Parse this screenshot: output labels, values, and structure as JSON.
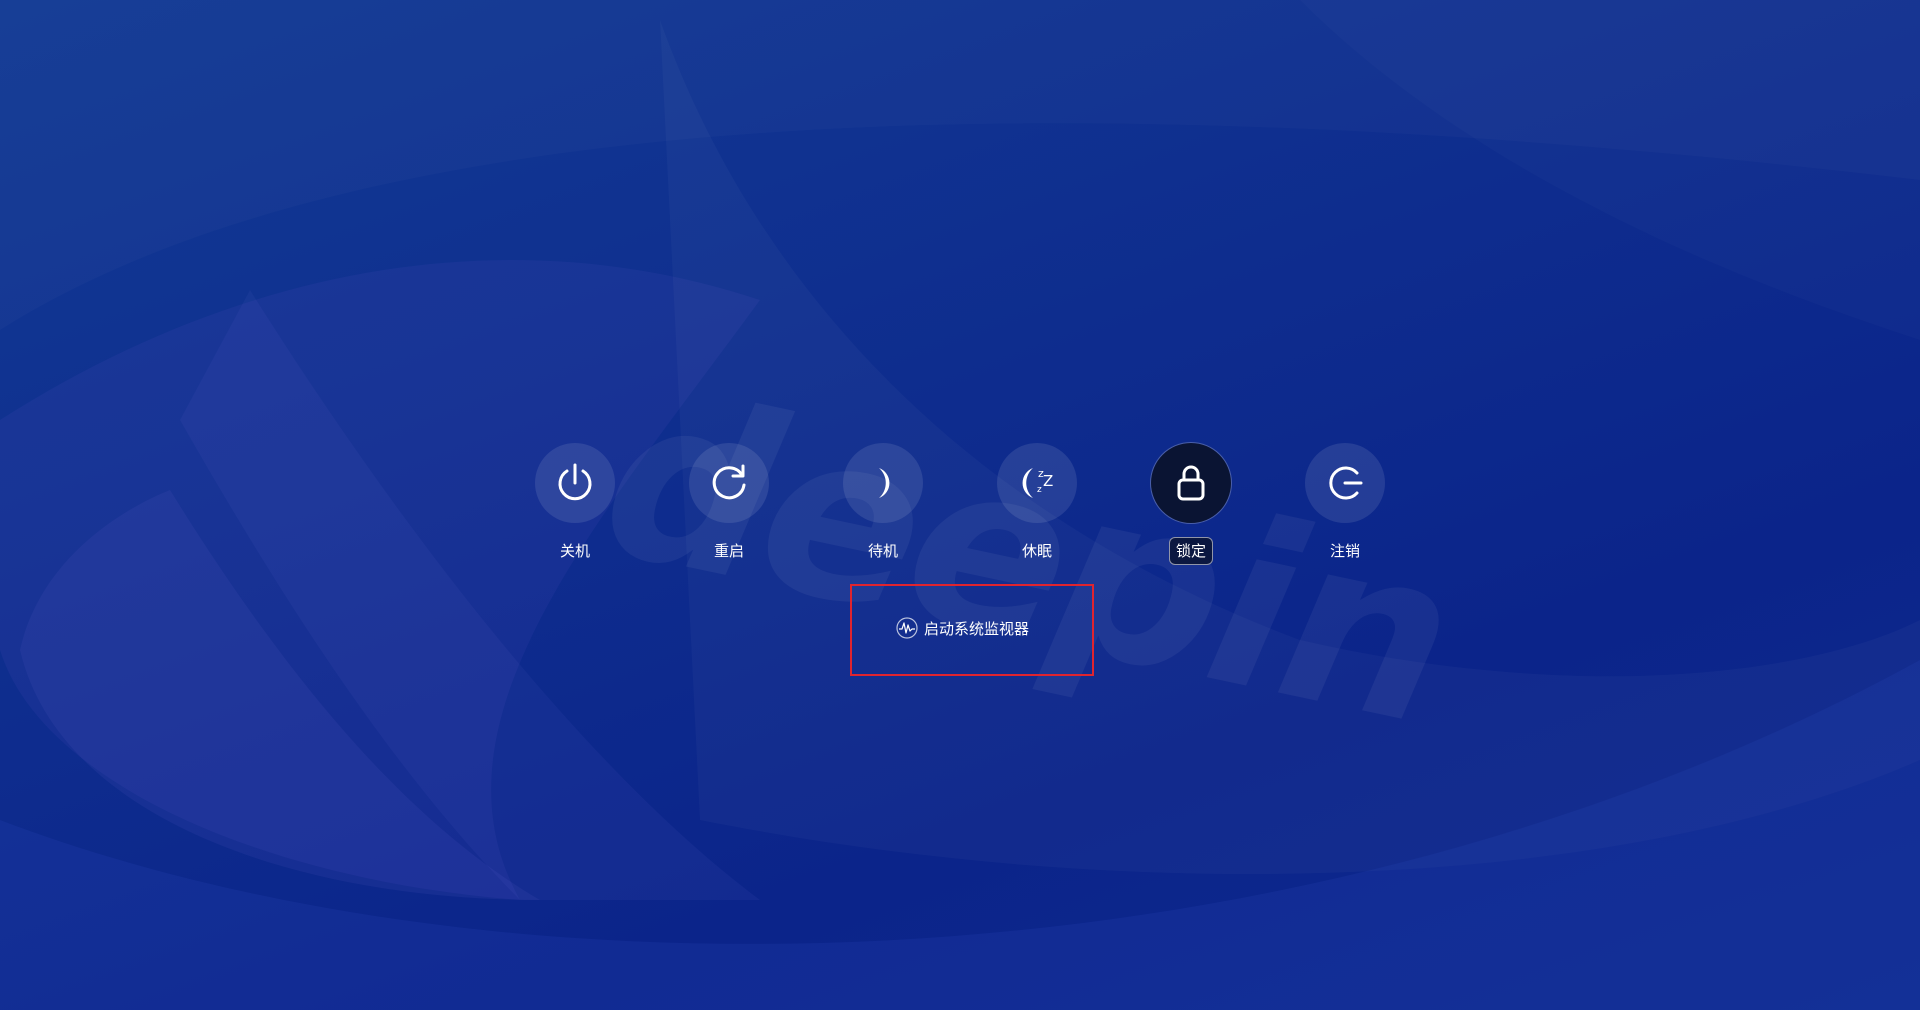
{
  "background": {
    "watermark_text": "deepin",
    "colors": {
      "base": "#0f2f8f",
      "accent": "#123a94"
    }
  },
  "actions": [
    {
      "id": "shutdown",
      "label": "关机",
      "icon": "power-icon",
      "selected": false
    },
    {
      "id": "reboot",
      "label": "重启",
      "icon": "restart-icon",
      "selected": false
    },
    {
      "id": "suspend",
      "label": "待机",
      "icon": "moon-icon",
      "selected": false
    },
    {
      "id": "hibernate",
      "label": "休眠",
      "icon": "sleep-zzz-icon",
      "selected": false
    },
    {
      "id": "lock",
      "label": "锁定",
      "icon": "lock-icon",
      "selected": true
    },
    {
      "id": "logout",
      "label": "注销",
      "icon": "logout-icon",
      "selected": false
    }
  ],
  "system_monitor": {
    "label": "启动系统监视器",
    "icon": "system-monitor-icon",
    "highlight_color": "#e0242f"
  }
}
